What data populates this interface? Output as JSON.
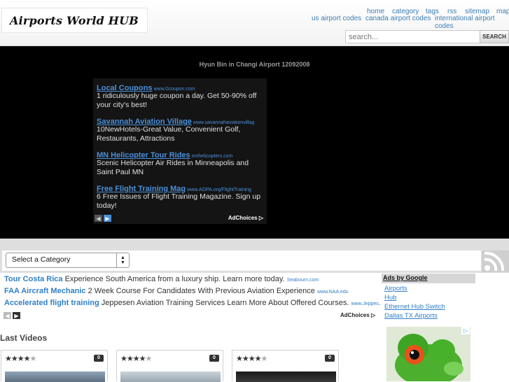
{
  "header": {
    "logo_text": "Airports World HUB",
    "nav_primary": [
      "home",
      "category",
      "tags",
      "rss",
      "sitemap",
      "map"
    ],
    "nav_secondary": [
      "us airport codes",
      "canada airport codes",
      "international airport codes"
    ],
    "search_placeholder": "search...",
    "search_button": "SEARCH"
  },
  "video": {
    "title": "Hyun Bin in Changi Airport 12092008"
  },
  "overlay_ads": {
    "items": [
      {
        "title": "Local Coupons",
        "url": "www.Groupon.com",
        "text": "1 ridiculously huge coupon a day. Get 50-90% off your city's best!"
      },
      {
        "title": "Savannah Aviation Village",
        "url": "www.savannahaviationvillag",
        "text": "10NewHotels-Great Value, Convenient Golf, Restaurants, Attractions"
      },
      {
        "title": "MN Helicopter Tour Rides",
        "url": "mnhelicopters.com",
        "text": "Scenic Helicopter Air Rides in Minneapolis and Saint Paul MN"
      },
      {
        "title": "Free Flight Training Mag",
        "url": "www.AOPA.org/FlightTraining",
        "text": "6 Free Issues of Flight Training Magazine. Sign up today!"
      }
    ],
    "prev_icon": "◀",
    "next_icon": "▶",
    "adchoices": "AdChoices"
  },
  "category_bar": {
    "select_label": "Select a Category"
  },
  "text_ads": {
    "items": [
      {
        "title": "Tour Costa Rica",
        "text": "Experience South America from a luxury ship. Learn more today.",
        "url": "Seabourn.com"
      },
      {
        "title": "FAA Aircraft Mechanic",
        "text": "2 Week Course For Candidates With Previous Aviation Experience",
        "url": "www.NAA.edu"
      },
      {
        "title": "Accelerated flight training",
        "text": "Jeppesen Aviation Training Services Learn More About Offered Courses.",
        "url": "www.Jeppes..."
      }
    ],
    "prev_icon": "◀",
    "next_icon": "▶",
    "adchoices": "AdChoices"
  },
  "google_ads": {
    "heading": "Ads by Google",
    "links": [
      "Airports",
      "Hub",
      "Ethernet Hub Switch",
      "Dallas TX Airports"
    ]
  },
  "last_videos": {
    "heading": "Last Videos",
    "cards": [
      {
        "rating": 4,
        "count": "0"
      },
      {
        "rating": 4,
        "count": "0"
      },
      {
        "rating": 4,
        "count": "0"
      }
    ]
  },
  "icons": {
    "search": "search-icon",
    "rss": "rss-icon",
    "ad_info": "ad-info-icon"
  }
}
